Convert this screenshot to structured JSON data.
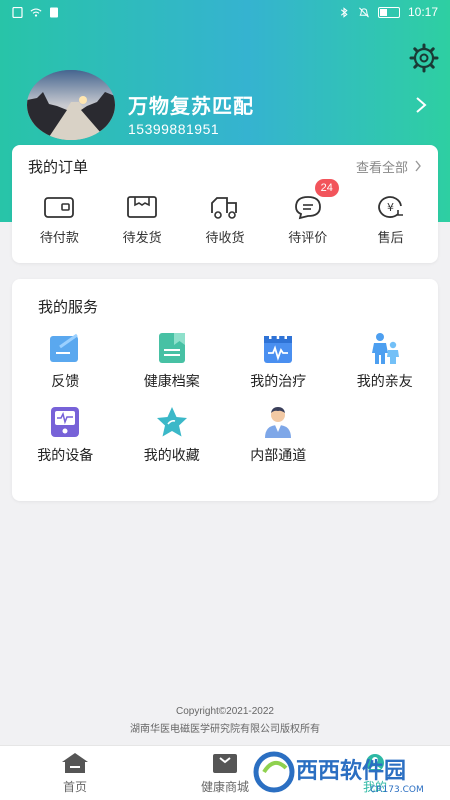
{
  "status_bar": {
    "time": "10:17"
  },
  "profile": {
    "name": "万物复苏匹配",
    "phone": "15399881951"
  },
  "orders": {
    "title": "我的订单",
    "view_all": "查看全部",
    "items": [
      {
        "label": "待付款",
        "icon": "wallet-icon"
      },
      {
        "label": "待发货",
        "icon": "package-icon"
      },
      {
        "label": "待收货",
        "icon": "delivery-truck-icon"
      },
      {
        "label": "待评价",
        "icon": "chat-bubble-icon",
        "badge": "24"
      },
      {
        "label": "售后",
        "icon": "yen-refund-icon"
      }
    ]
  },
  "services": {
    "title": "我的服务",
    "items": [
      {
        "label": "反馈",
        "icon": "feedback-icon"
      },
      {
        "label": "健康档案",
        "icon": "health-record-icon"
      },
      {
        "label": "我的治疗",
        "icon": "calendar-treatment-icon"
      },
      {
        "label": "我的亲友",
        "icon": "family-icon"
      },
      {
        "label": "我的设备",
        "icon": "device-icon"
      },
      {
        "label": "我的收藏",
        "icon": "star-icon"
      },
      {
        "label": "内部通道",
        "icon": "staff-icon"
      }
    ]
  },
  "footer": {
    "copyright": "Copyright©2021-2022",
    "owner": "湖南华医电磁医学研究院有限公司版权所有"
  },
  "tabbar": {
    "tabs": [
      {
        "label": "首页",
        "icon": "home-icon"
      },
      {
        "label": "健康商城",
        "icon": "shopping-bag-icon"
      },
      {
        "label": "我的",
        "icon": "profile-icon",
        "active": true
      }
    ]
  },
  "watermark": {
    "text": "西西软件园",
    "subtext": "CR173.COM"
  },
  "colors": {
    "accent": "#2db8a4",
    "header_start": "#28c4a8",
    "badge": "#f2545b",
    "service_blue": "#4a90e2"
  }
}
